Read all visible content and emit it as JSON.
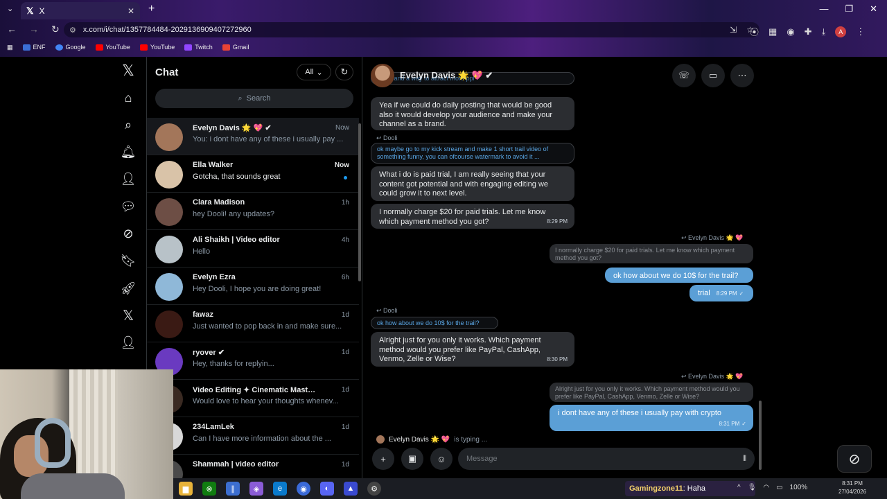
{
  "browser": {
    "tab_title": "X",
    "tab_icon": "x-logo-icon",
    "url": "x.com/i/chat/1357784484-2029136909407272960",
    "bookmarks": [
      {
        "label": "ENF",
        "color": "#3b6fd6"
      },
      {
        "label": "Google",
        "color": "#4285f4"
      },
      {
        "label": "YouTube",
        "color": "#ff0000"
      },
      {
        "label": "YouTube",
        "color": "#ff0000"
      },
      {
        "label": "Twitch",
        "color": "#9146ff"
      },
      {
        "label": "Gmail",
        "color": "#ea4335"
      }
    ],
    "profile_initial": "A"
  },
  "chatlist": {
    "title": "Chat",
    "filter_label": "All",
    "search_placeholder": "Search",
    "conversations": [
      {
        "name": "Evelyn Davis 🌟 💖 ✔",
        "time": "Now",
        "preview": "You: i dont have any of these i usually pay ...",
        "avatar_color": "#a3765a",
        "active": true
      },
      {
        "name": "Ella Walker",
        "time": "Now",
        "preview": "Gotcha, that sounds great",
        "avatar_color": "#d9c3a8",
        "unread": true
      },
      {
        "name": "Clara Madison",
        "time": "1h",
        "preview": "hey Dooli! any updates?",
        "avatar_color": "#6d4e45"
      },
      {
        "name": "Ali Shaikh | Video editor",
        "time": "4h",
        "preview": "Hello",
        "avatar_color": "#b8c2c8"
      },
      {
        "name": "Evelyn Ezra",
        "time": "6h",
        "preview": "Hey Dooli, I hope you are doing great!",
        "avatar_color": "#8fb8d8"
      },
      {
        "name": "fawaz",
        "time": "1d",
        "preview": "Just wanted to pop back in and make sure...",
        "avatar_color": "#3a1a14"
      },
      {
        "name": "ryover ✔",
        "time": "1d",
        "preview": "Hey, thanks for replyin...",
        "avatar_color": "#6a3ac0"
      },
      {
        "name": "Video Editing ✦ Cinematic Masterpie...",
        "time": "1d",
        "preview": "Would love to hear your thoughts whenev...",
        "avatar_color": "#3a2a22"
      },
      {
        "name": "234LamLek",
        "time": "1d",
        "preview": "Can I have more information about the ...",
        "avatar_color": "#d8d8d8"
      },
      {
        "name": "Shammah | video editor",
        "time": "1d",
        "preview": "",
        "avatar_color": "#4a4a4a"
      }
    ]
  },
  "conversation": {
    "contact_name": "Evelyn Davis 🌟 💖 ✔",
    "cut_top_text": "funny and a way to attract more ppl",
    "messages_in_1": [
      {
        "text": "Yea if we could do daily posting that would be good also it would develop your audience and make your channel as a brand."
      }
    ],
    "reply_to_label_1": "↩ Dooli",
    "quote_1": "ok maybe go to my kick stream and make 1 short trail video of something funny, you can ofcourse watermark to avoid it ...",
    "msg_2": "What i do is paid trial, I am really seeing that your content got potential and with engaging editing we could grow it to next level.",
    "msg_3": "I normally charge $20 for paid trials. Let me know which payment method you got?",
    "msg_3_time": "8:29 PM",
    "reply_to_label_2": "↩ Evelyn Davis 🌟 💖",
    "quote_2": "I normally charge $20 for paid trials. Let me know which payment method you got?",
    "out_1": "ok how about we do 10$ for the trail?",
    "out_2": "trial",
    "out_2_time": "8:29 PM",
    "reply_to_label_3": "↩ Dooli",
    "quote_3": "ok how about we do 10$ for the trail?",
    "msg_4": "Alright just for you only it works. Which payment method would you prefer like PayPal, CashApp, Venmo, Zelle or Wise?",
    "msg_4_time": "8:30 PM",
    "reply_to_label_4": "↩ Evelyn Davis 🌟 💖",
    "quote_4": "Alright just for you only it works. Which payment method would you prefer like PayPal, CashApp, Venmo, Zelle or Wise?",
    "out_3": "i dont have any of these i usually pay with crypto",
    "out_3_time": "8:31 PM",
    "typing_name": "Evelyn Davis 🌟 💖",
    "typing_suffix": "is typing ...",
    "composer_placeholder": "Message"
  },
  "taskbar": {
    "notification_user": "Gamingzone11",
    "notification_text": ": Haha",
    "battery": "100%",
    "time": "8:31 PM",
    "date": "27/04/2026"
  }
}
